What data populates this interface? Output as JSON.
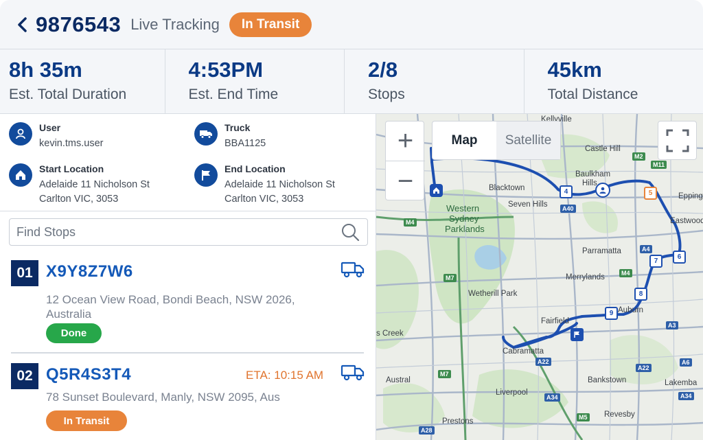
{
  "header": {
    "order_id": "9876543",
    "subtitle": "Live Tracking",
    "status": "In Transit"
  },
  "stats": [
    {
      "value": "8h 35m",
      "label": "Est. Total Duration"
    },
    {
      "value": "4:53PM",
      "label": "Est. End Time"
    },
    {
      "value": "2/8",
      "label": "Stops"
    },
    {
      "value": "45km",
      "label": "Total Distance"
    }
  ],
  "info": {
    "user_title": "User",
    "user_value": "kevin.tms.user",
    "truck_title": "Truck",
    "truck_value": "BBA1125",
    "start_title": "Start Location",
    "start_line1": "Adelaide 11 Nicholson St",
    "start_line2": "Carlton VIC, 3053",
    "end_title": "End  Location",
    "end_line1": "Adelaide 11 Nicholson St",
    "end_line2": "Carlton VIC, 3053"
  },
  "search": {
    "placeholder": "Find Stops"
  },
  "stops": [
    {
      "num": "01",
      "code": "X9Y8Z7W6",
      "address": "12 Ocean View Road, Bondi Beach, NSW 2026, Australia",
      "status": "Done",
      "eta": ""
    },
    {
      "num": "02",
      "code": "Q5R4S3T4",
      "address": "78 Sunset Boulevard, Manly, NSW 2095, Aus",
      "status": "In Transit",
      "eta": "ETA: 10:15 AM"
    }
  ],
  "map": {
    "zoom_in": "+",
    "zoom_out": "−",
    "map_label": "Map",
    "satellite_label": "Satellite",
    "places": {
      "kellyville": "Kellyville",
      "castle_hill": "Castle Hill",
      "baulkham": "Baulkham",
      "hills": "Hills",
      "blacktown": "Blacktown",
      "seven_hills": "Seven Hills",
      "epping": "Epping",
      "eastwood": "Eastwood",
      "western": "Western",
      "sydney": "Sydney",
      "parklands": "Parklands",
      "parramatta": "Parramatta",
      "merrylands": "Merrylands",
      "wetherill_park": "Wetherill Park",
      "auburn": "Auburn",
      "fairfield": "Fairfield",
      "creek": "s Creek",
      "cabramatta": "Cabramatta",
      "austral": "Austral",
      "bankstown": "Bankstown",
      "lakemba": "Lakemba",
      "liverpool": "Liverpool",
      "prestons": "Prestons",
      "revesby": "Revesby"
    },
    "roads": {
      "m4a": "M4",
      "a40": "A40",
      "m7": "M7",
      "m2": "M2",
      "m11": "M11",
      "a4": "A4",
      "m4b": "M4",
      "a3": "A3",
      "a22a": "A22",
      "a22b": "A22",
      "a34a": "A34",
      "a34b": "A34",
      "m7b": "M7",
      "m5": "M5",
      "a6": "A6",
      "a28": "A28"
    },
    "route_stops": [
      "4",
      "5",
      "6",
      "7",
      "8",
      "9"
    ]
  },
  "colors": {
    "primary": "#0b2a63",
    "accent_blue": "#1459b8",
    "transit_orange": "#e8843a",
    "done_green": "#27a74a",
    "route": "#1d4fb0"
  }
}
